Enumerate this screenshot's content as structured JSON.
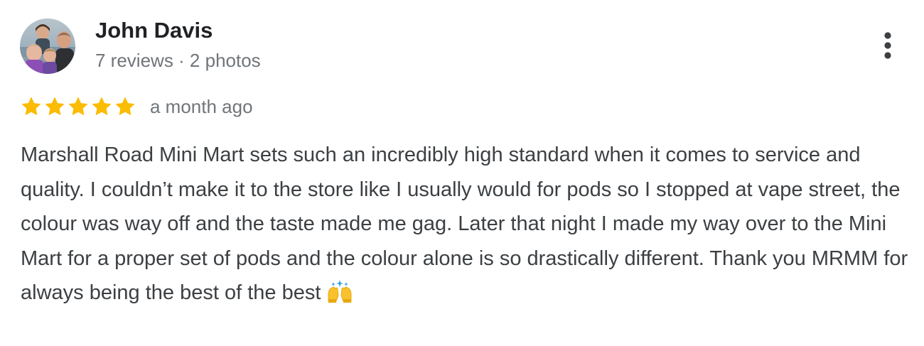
{
  "review": {
    "author": {
      "name": "John Davis",
      "meta": "7 reviews · 2 photos",
      "avatar_icon": "avatar-photo"
    },
    "rating": {
      "stars": 5,
      "max_stars": 5,
      "star_color": "#fbbc04",
      "star_icon": "star-icon"
    },
    "date": "a month ago",
    "text": "Marshall Road Mini Mart sets such an incredibly high standard when it comes to service and quality. I couldn’t make it to the store like I usually would for pods so I stopped at vape street, the colour was way off and the taste made me gag. Later that night I made my way over to the Mini Mart for a proper set of pods and the colour alone is so drastically different. Thank you MRMM for always being the best of the best",
    "trailing_emoji": "raising-hands-icon",
    "more_menu_icon": "more-vertical-icon"
  }
}
